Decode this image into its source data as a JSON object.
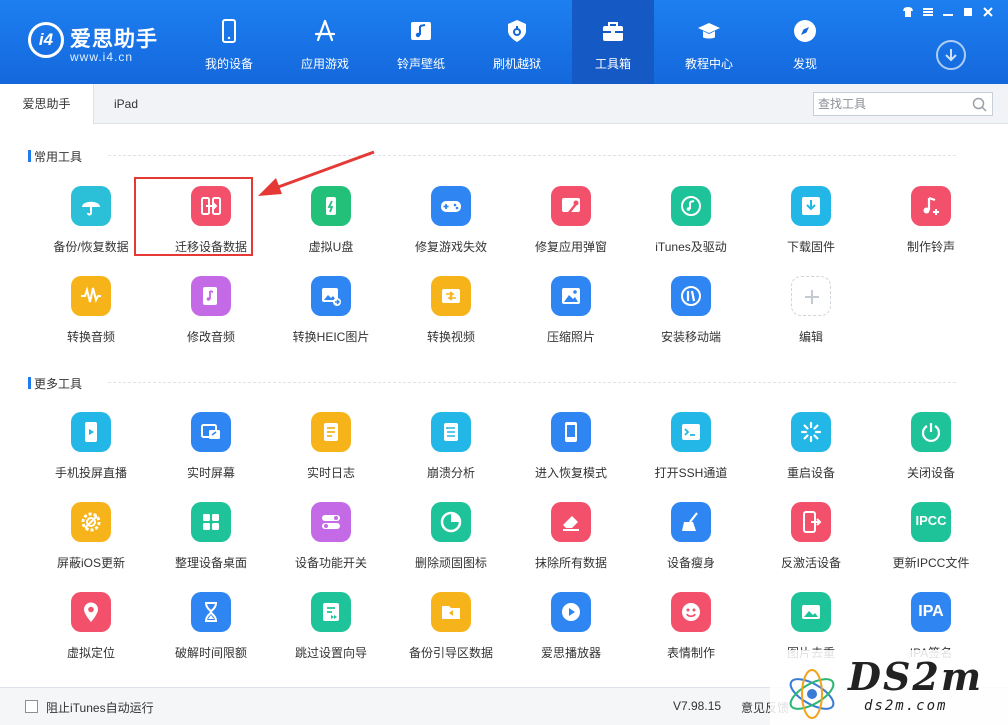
{
  "app": {
    "logo_name": "爱思助手",
    "logo_url": "www.i4.cn",
    "logo_mark": "i4"
  },
  "nav": [
    {
      "label": "我的设备",
      "icon": "phone-icon"
    },
    {
      "label": "应用游戏",
      "icon": "app-store-icon"
    },
    {
      "label": "铃声壁纸",
      "icon": "music-image-icon"
    },
    {
      "label": "刷机越狱",
      "icon": "shield-icon"
    },
    {
      "label": "工具箱",
      "icon": "toolbox-icon",
      "active": true
    },
    {
      "label": "教程中心",
      "icon": "graduation-cap-icon"
    },
    {
      "label": "发现",
      "icon": "compass-icon"
    }
  ],
  "subtabs": [
    "爱思助手",
    "iPad"
  ],
  "search": {
    "placeholder": "查找工具"
  },
  "sections": {
    "common_title": "常用工具",
    "more_title": "更多工具"
  },
  "common_tools": [
    {
      "label": "备份/恢复数据",
      "icon": "umbrella-icon",
      "color": "#2bc0d8"
    },
    {
      "label": "迁移设备数据",
      "icon": "migrate-icon",
      "color": "#f2506b"
    },
    {
      "label": "虚拟U盘",
      "icon": "usb-drive-icon",
      "color": "#23c07a"
    },
    {
      "label": "修复游戏失效",
      "icon": "gamepad-icon",
      "color": "#2f86f2"
    },
    {
      "label": "修复应用弹窗",
      "icon": "wrench-icon",
      "color": "#f2506b"
    },
    {
      "label": "iTunes及驱动",
      "icon": "itunes-icon",
      "color": "#1fc39a"
    },
    {
      "label": "下载固件",
      "icon": "download-box-icon",
      "color": "#23b7e8"
    },
    {
      "label": "制作铃声",
      "icon": "music-note-add-icon",
      "color": "#f2506b"
    },
    {
      "label": "转换音频",
      "icon": "waveform-icon",
      "color": "#f7b41a"
    },
    {
      "label": "修改音频",
      "icon": "audio-edit-icon",
      "color": "#c46ae6"
    },
    {
      "label": "转换HEIC图片",
      "icon": "image-convert-icon",
      "color": "#2f86f2"
    },
    {
      "label": "转换视频",
      "icon": "video-convert-icon",
      "color": "#f7b41a"
    },
    {
      "label": "压缩照片",
      "icon": "photo-icon",
      "color": "#2f86f2"
    },
    {
      "label": "安装移动端",
      "icon": "i4-app-icon",
      "color": "#2f86f2"
    },
    {
      "label": "编辑",
      "icon": "plus-icon",
      "color": "#ffffff"
    }
  ],
  "more_tools": [
    {
      "label": "手机投屏直播",
      "icon": "screen-cast-icon",
      "color": "#23b7e8"
    },
    {
      "label": "实时屏幕",
      "icon": "realtime-screen-icon",
      "color": "#2f86f2"
    },
    {
      "label": "实时日志",
      "icon": "log-icon",
      "color": "#f7b41a"
    },
    {
      "label": "崩溃分析",
      "icon": "crash-report-icon",
      "color": "#23b7e8"
    },
    {
      "label": "进入恢复模式",
      "icon": "recovery-icon",
      "color": "#2f86f2"
    },
    {
      "label": "打开SSH通道",
      "icon": "terminal-icon",
      "color": "#23b7e8"
    },
    {
      "label": "重启设备",
      "icon": "restart-icon",
      "color": "#23b7e8"
    },
    {
      "label": "关闭设备",
      "icon": "power-icon",
      "color": "#1fc39a"
    },
    {
      "label": "屏蔽iOS更新",
      "icon": "gear-block-icon",
      "color": "#f7b41a"
    },
    {
      "label": "整理设备桌面",
      "icon": "grid-icon",
      "color": "#1fc39a"
    },
    {
      "label": "设备功能开关",
      "icon": "toggle-icon",
      "color": "#c46ae6"
    },
    {
      "label": "删除顽固图标",
      "icon": "pie-icon",
      "color": "#1fc39a"
    },
    {
      "label": "抹除所有数据",
      "icon": "eraser-icon",
      "color": "#f2506b"
    },
    {
      "label": "设备瘦身",
      "icon": "broom-icon",
      "color": "#2f86f2"
    },
    {
      "label": "反激活设备",
      "icon": "deactivate-icon",
      "color": "#f2506b"
    },
    {
      "label": "更新IPCC文件",
      "icon": "ipcc-icon",
      "color": "#1fc39a",
      "text": "IPCC"
    },
    {
      "label": "虚拟定位",
      "icon": "location-pin-icon",
      "color": "#f2506b"
    },
    {
      "label": "破解时间限额",
      "icon": "hourglass-icon",
      "color": "#2f86f2"
    },
    {
      "label": "跳过设置向导",
      "icon": "skip-guide-icon",
      "color": "#1fc39a"
    },
    {
      "label": "备份引导区数据",
      "icon": "folder-backup-icon",
      "color": "#f7b41a"
    },
    {
      "label": "爱思播放器",
      "icon": "play-icon",
      "color": "#2f86f2"
    },
    {
      "label": "表情制作",
      "icon": "emoji-icon",
      "color": "#f2506b"
    },
    {
      "label": "图片去重",
      "icon": "image-dedupe-icon",
      "color": "#1fc39a"
    },
    {
      "label": "IPA签名",
      "icon": "ipa-icon",
      "color": "#2f86f2",
      "text": "IPA"
    }
  ],
  "footer": {
    "itunes_autorun": "阻止iTunes自动运行",
    "version": "V7.98.15",
    "feedback": "意见反馈"
  },
  "watermark": {
    "big": "DS2m",
    "small": "ds2m.com"
  }
}
